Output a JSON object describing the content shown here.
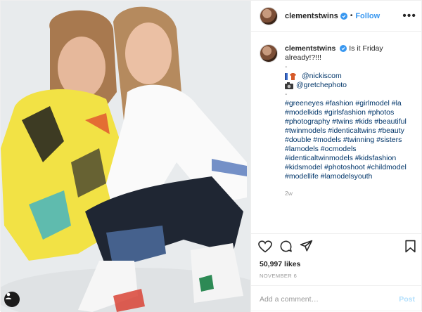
{
  "colors": {
    "link": "#003569",
    "accent": "#3897f0",
    "text": "#262626",
    "muted": "#999999",
    "border": "#efefef"
  },
  "photo": {
    "tag_icon": "person-tag-icon"
  },
  "header": {
    "username": "clementstwins",
    "verified_icon": "verified-badge-icon",
    "separator": "•",
    "follow_label": "Follow",
    "more_icon": "more-options-icon",
    "more_glyph": "•••"
  },
  "caption": {
    "username": "clementstwins",
    "text": "Is it Friday already!?!!!",
    "dash": "-",
    "credits": [
      {
        "icon": "clothes-emoji-icon",
        "text": "@nickiscom"
      },
      {
        "icon": "camera-emoji-icon",
        "text": "@gretchephoto"
      }
    ],
    "hashtags": "#greeneyes #fashion #girlmodel #la #modelkids #girlsfashion #photos #photography #twins #kids #beautiful #twinmodels #identicaltwins #beauty #double #models #twinning #sisters #lamodels #ocmodels #identicaltwinmodels #kidsfashion #kidsmodel #photoshoot #childmodel #modellife #lamodelsyouth",
    "age": "2w"
  },
  "actions": {
    "like_icon": "heart-icon",
    "comment_icon": "comment-icon",
    "share_icon": "share-icon",
    "save_icon": "bookmark-icon"
  },
  "likes": "50,997 likes",
  "date": "NOVEMBER 6",
  "add_comment": {
    "placeholder": "Add a comment…",
    "post_label": "Post"
  }
}
